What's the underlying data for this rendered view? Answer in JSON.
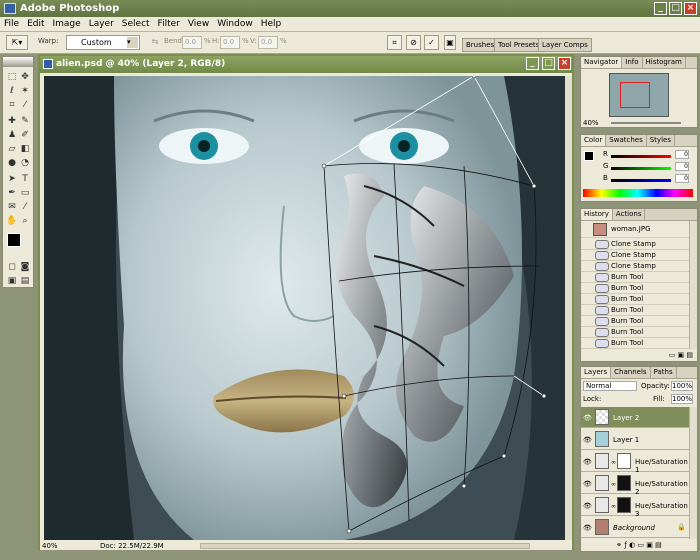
{
  "window": {
    "title": "Adobe Photoshop",
    "min": "_",
    "max": "□",
    "close": "×"
  },
  "menu": [
    "File",
    "Edit",
    "Image",
    "Layer",
    "Select",
    "Filter",
    "View",
    "Window",
    "Help"
  ],
  "options": {
    "warp_label": "Warp:",
    "warp_value": "Custom",
    "bend_label": "Bend:",
    "bend_value": "0.0",
    "h_label": "H:",
    "h_value": "0.0",
    "v_label": "V:",
    "v_value": "0.0",
    "pct": "%",
    "well_tabs": [
      "Brushes",
      "Tool Presets",
      "Layer Comps"
    ]
  },
  "document": {
    "title": "alien.psd @ 40% (Layer 2, RGB/8)",
    "zoom": "40%",
    "doc_info": "Doc: 22.5M/22.9M"
  },
  "navigator": {
    "tabs": [
      "Navigator",
      "Info",
      "Histogram"
    ],
    "zoom": "40%"
  },
  "color": {
    "tabs": [
      "Color",
      "Swatches",
      "Styles"
    ],
    "channels": [
      "R",
      "G",
      "B"
    ],
    "values": [
      "0",
      "0",
      "0"
    ]
  },
  "history": {
    "tabs": [
      "History",
      "Actions"
    ],
    "snapshot": "woman.JPG",
    "items": [
      "Clone Stamp",
      "Clone Stamp",
      "Clone Stamp",
      "Burn Tool",
      "Burn Tool",
      "Burn Tool",
      "Burn Tool",
      "Burn Tool",
      "Burn Tool",
      "Burn Tool"
    ]
  },
  "layers": {
    "tabs": [
      "Layers",
      "Channels",
      "Paths"
    ],
    "blend_mode": "Normal",
    "opacity_label": "Opacity:",
    "opacity": "100%",
    "lock_label": "Lock:",
    "fill_label": "Fill:",
    "fill": "100%",
    "items": [
      "Layer 2",
      "Layer 1",
      "Hue/Saturation 1",
      "Hue/Saturation 2",
      "Hue/Saturation 3",
      "Background"
    ]
  },
  "colors": {
    "titlebar": "#6b8048",
    "doc_title": "#7f9655",
    "panel_bg": "#ece9d8",
    "selected_layer": "#7f8e5a"
  }
}
